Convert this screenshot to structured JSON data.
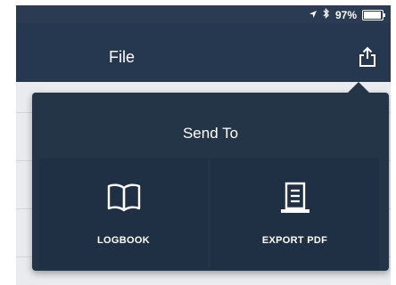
{
  "status_bar": {
    "battery_text": "97%",
    "battery_level": 0.97,
    "icons": [
      "location-icon",
      "bluetooth-icon",
      "battery-icon"
    ]
  },
  "nav": {
    "title": "File",
    "share_icon": "share-icon"
  },
  "popover": {
    "title": "Send To",
    "options": [
      {
        "label": "LOGBOOK",
        "icon": "book-icon"
      },
      {
        "label": "EXPORT PDF",
        "icon": "document-icon"
      }
    ]
  },
  "colors": {
    "nav_background": "#263850",
    "popover_background": "#243548",
    "option_background": "#203044",
    "text": "#ffffff"
  }
}
